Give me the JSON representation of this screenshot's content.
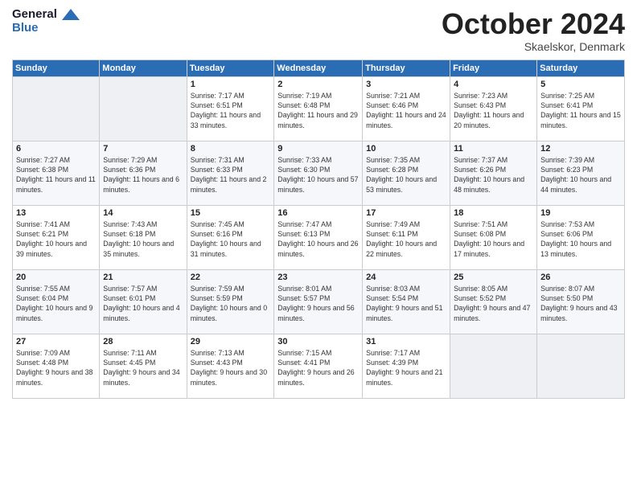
{
  "logo": {
    "general": "General",
    "blue": "Blue"
  },
  "header": {
    "title": "October 2024",
    "subtitle": "Skaelskor, Denmark"
  },
  "days_of_week": [
    "Sunday",
    "Monday",
    "Tuesday",
    "Wednesday",
    "Thursday",
    "Friday",
    "Saturday"
  ],
  "weeks": [
    [
      null,
      null,
      {
        "day": "1",
        "sunrise": "Sunrise: 7:17 AM",
        "sunset": "Sunset: 6:51 PM",
        "daylight": "Daylight: 11 hours and 33 minutes."
      },
      {
        "day": "2",
        "sunrise": "Sunrise: 7:19 AM",
        "sunset": "Sunset: 6:48 PM",
        "daylight": "Daylight: 11 hours and 29 minutes."
      },
      {
        "day": "3",
        "sunrise": "Sunrise: 7:21 AM",
        "sunset": "Sunset: 6:46 PM",
        "daylight": "Daylight: 11 hours and 24 minutes."
      },
      {
        "day": "4",
        "sunrise": "Sunrise: 7:23 AM",
        "sunset": "Sunset: 6:43 PM",
        "daylight": "Daylight: 11 hours and 20 minutes."
      },
      {
        "day": "5",
        "sunrise": "Sunrise: 7:25 AM",
        "sunset": "Sunset: 6:41 PM",
        "daylight": "Daylight: 11 hours and 15 minutes."
      }
    ],
    [
      {
        "day": "6",
        "sunrise": "Sunrise: 7:27 AM",
        "sunset": "Sunset: 6:38 PM",
        "daylight": "Daylight: 11 hours and 11 minutes."
      },
      {
        "day": "7",
        "sunrise": "Sunrise: 7:29 AM",
        "sunset": "Sunset: 6:36 PM",
        "daylight": "Daylight: 11 hours and 6 minutes."
      },
      {
        "day": "8",
        "sunrise": "Sunrise: 7:31 AM",
        "sunset": "Sunset: 6:33 PM",
        "daylight": "Daylight: 11 hours and 2 minutes."
      },
      {
        "day": "9",
        "sunrise": "Sunrise: 7:33 AM",
        "sunset": "Sunset: 6:30 PM",
        "daylight": "Daylight: 10 hours and 57 minutes."
      },
      {
        "day": "10",
        "sunrise": "Sunrise: 7:35 AM",
        "sunset": "Sunset: 6:28 PM",
        "daylight": "Daylight: 10 hours and 53 minutes."
      },
      {
        "day": "11",
        "sunrise": "Sunrise: 7:37 AM",
        "sunset": "Sunset: 6:26 PM",
        "daylight": "Daylight: 10 hours and 48 minutes."
      },
      {
        "day": "12",
        "sunrise": "Sunrise: 7:39 AM",
        "sunset": "Sunset: 6:23 PM",
        "daylight": "Daylight: 10 hours and 44 minutes."
      }
    ],
    [
      {
        "day": "13",
        "sunrise": "Sunrise: 7:41 AM",
        "sunset": "Sunset: 6:21 PM",
        "daylight": "Daylight: 10 hours and 39 minutes."
      },
      {
        "day": "14",
        "sunrise": "Sunrise: 7:43 AM",
        "sunset": "Sunset: 6:18 PM",
        "daylight": "Daylight: 10 hours and 35 minutes."
      },
      {
        "day": "15",
        "sunrise": "Sunrise: 7:45 AM",
        "sunset": "Sunset: 6:16 PM",
        "daylight": "Daylight: 10 hours and 31 minutes."
      },
      {
        "day": "16",
        "sunrise": "Sunrise: 7:47 AM",
        "sunset": "Sunset: 6:13 PM",
        "daylight": "Daylight: 10 hours and 26 minutes."
      },
      {
        "day": "17",
        "sunrise": "Sunrise: 7:49 AM",
        "sunset": "Sunset: 6:11 PM",
        "daylight": "Daylight: 10 hours and 22 minutes."
      },
      {
        "day": "18",
        "sunrise": "Sunrise: 7:51 AM",
        "sunset": "Sunset: 6:08 PM",
        "daylight": "Daylight: 10 hours and 17 minutes."
      },
      {
        "day": "19",
        "sunrise": "Sunrise: 7:53 AM",
        "sunset": "Sunset: 6:06 PM",
        "daylight": "Daylight: 10 hours and 13 minutes."
      }
    ],
    [
      {
        "day": "20",
        "sunrise": "Sunrise: 7:55 AM",
        "sunset": "Sunset: 6:04 PM",
        "daylight": "Daylight: 10 hours and 9 minutes."
      },
      {
        "day": "21",
        "sunrise": "Sunrise: 7:57 AM",
        "sunset": "Sunset: 6:01 PM",
        "daylight": "Daylight: 10 hours and 4 minutes."
      },
      {
        "day": "22",
        "sunrise": "Sunrise: 7:59 AM",
        "sunset": "Sunset: 5:59 PM",
        "daylight": "Daylight: 10 hours and 0 minutes."
      },
      {
        "day": "23",
        "sunrise": "Sunrise: 8:01 AM",
        "sunset": "Sunset: 5:57 PM",
        "daylight": "Daylight: 9 hours and 56 minutes."
      },
      {
        "day": "24",
        "sunrise": "Sunrise: 8:03 AM",
        "sunset": "Sunset: 5:54 PM",
        "daylight": "Daylight: 9 hours and 51 minutes."
      },
      {
        "day": "25",
        "sunrise": "Sunrise: 8:05 AM",
        "sunset": "Sunset: 5:52 PM",
        "daylight": "Daylight: 9 hours and 47 minutes."
      },
      {
        "day": "26",
        "sunrise": "Sunrise: 8:07 AM",
        "sunset": "Sunset: 5:50 PM",
        "daylight": "Daylight: 9 hours and 43 minutes."
      }
    ],
    [
      {
        "day": "27",
        "sunrise": "Sunrise: 7:09 AM",
        "sunset": "Sunset: 4:48 PM",
        "daylight": "Daylight: 9 hours and 38 minutes."
      },
      {
        "day": "28",
        "sunrise": "Sunrise: 7:11 AM",
        "sunset": "Sunset: 4:45 PM",
        "daylight": "Daylight: 9 hours and 34 minutes."
      },
      {
        "day": "29",
        "sunrise": "Sunrise: 7:13 AM",
        "sunset": "Sunset: 4:43 PM",
        "daylight": "Daylight: 9 hours and 30 minutes."
      },
      {
        "day": "30",
        "sunrise": "Sunrise: 7:15 AM",
        "sunset": "Sunset: 4:41 PM",
        "daylight": "Daylight: 9 hours and 26 minutes."
      },
      {
        "day": "31",
        "sunrise": "Sunrise: 7:17 AM",
        "sunset": "Sunset: 4:39 PM",
        "daylight": "Daylight: 9 hours and 21 minutes."
      },
      null,
      null
    ]
  ]
}
